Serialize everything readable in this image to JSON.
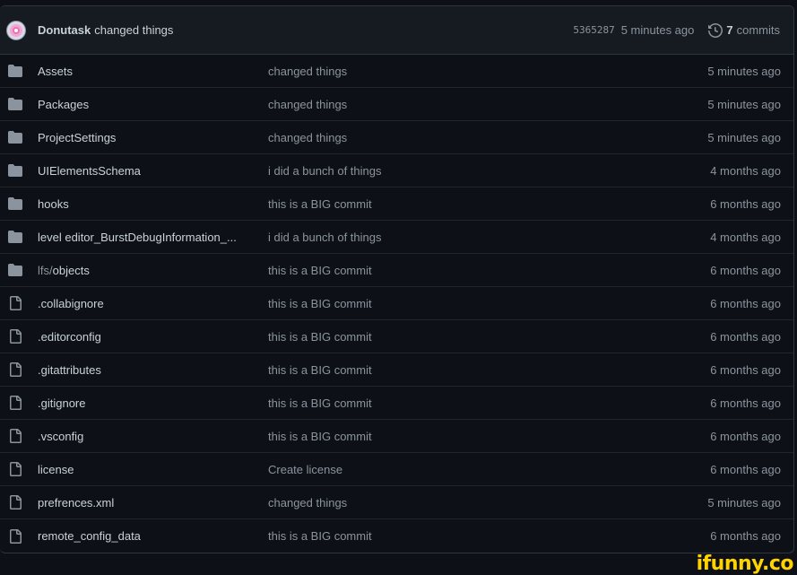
{
  "commit": {
    "author": "Donutask",
    "message": "changed things",
    "sha": "5365287",
    "time": "5 minutes ago",
    "commits_count": "7",
    "commits_label": "commits"
  },
  "entries": [
    {
      "name": "Assets",
      "type": "folder",
      "message": "changed things",
      "age": "5 minutes ago"
    },
    {
      "name": "Packages",
      "type": "folder",
      "message": "changed things",
      "age": "5 minutes ago"
    },
    {
      "name": "ProjectSettings",
      "type": "folder",
      "message": "changed things",
      "age": "5 minutes ago"
    },
    {
      "name": "UIElementsSchema",
      "type": "folder",
      "message": "i did a bunch of things",
      "age": "4 months ago"
    },
    {
      "name": "hooks",
      "type": "folder",
      "message": "this is a BIG commit",
      "age": "6 months ago"
    },
    {
      "name": "level editor_BurstDebugInformation_...",
      "type": "folder",
      "message": "i did a bunch of things",
      "age": "4 months ago"
    },
    {
      "name_prefix": "lfs/",
      "name": "objects",
      "type": "folder",
      "message": "this is a BIG commit",
      "age": "6 months ago"
    },
    {
      "name": ".collabignore",
      "type": "file",
      "message": "this is a BIG commit",
      "age": "6 months ago"
    },
    {
      "name": ".editorconfig",
      "type": "file",
      "message": "this is a BIG commit",
      "age": "6 months ago"
    },
    {
      "name": ".gitattributes",
      "type": "file",
      "message": "this is a BIG commit",
      "age": "6 months ago"
    },
    {
      "name": ".gitignore",
      "type": "file",
      "message": "this is a BIG commit",
      "age": "6 months ago"
    },
    {
      "name": ".vsconfig",
      "type": "file",
      "message": "this is a BIG commit",
      "age": "6 months ago"
    },
    {
      "name": "license",
      "type": "file",
      "message": "Create license",
      "age": "6 months ago"
    },
    {
      "name": "prefrences.xml",
      "type": "file",
      "message": "changed things",
      "age": "5 minutes ago"
    },
    {
      "name": "remote_config_data",
      "type": "file",
      "message": "this is a BIG commit",
      "age": "6 months ago"
    }
  ],
  "watermark": "ifunny.co",
  "colors": {
    "background": "#0d1117",
    "header": "#161b22",
    "border": "#30363d",
    "text": "#c9d1d9",
    "muted": "#8b949e",
    "folder_icon": "#8b949e",
    "watermark": "#ffd200"
  },
  "icons": {
    "folder": "folder-icon",
    "file": "file-icon",
    "history": "history-icon"
  }
}
